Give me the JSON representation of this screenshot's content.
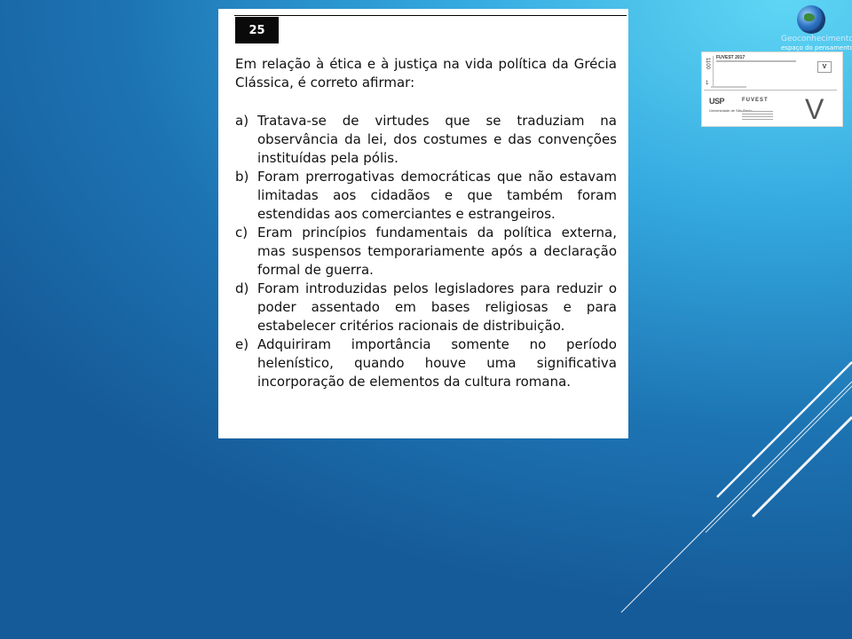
{
  "question": {
    "number": "25",
    "stem": "Em relação à ética e à justiça na vida política da Grécia Clássica, é correto afirmar:",
    "options": [
      {
        "letter": "a)",
        "text": "Tratava-se de virtudes que se traduziam na observância da lei, dos costumes e das convenções instituídas pela pólis."
      },
      {
        "letter": "b)",
        "text": "Foram prerrogativas democráticas que não estavam limitadas aos cidadãos e que também foram estendidas aos comerciantes e estrangeiros."
      },
      {
        "letter": "c)",
        "text": "Eram princípios fundamentais da política externa, mas suspensos temporariamente após a declaração formal de guerra."
      },
      {
        "letter": "d)",
        "text": "Foram introduzidas pelos legisladores para reduzir o poder assentado em bases religiosas e para estabelecer critérios racionais de distribuição."
      },
      {
        "letter": "e)",
        "text": "Adquiriram importância somente no período helenístico, quando houve uma significativa incorporação de elementos da cultura romana."
      }
    ]
  },
  "branding": {
    "site": "Geoconhecimento.com",
    "tagline": "espaço do pensamento",
    "logo_icon": "globe-icon"
  },
  "exam_thumbnail": {
    "number_top": "1100",
    "number_bottom": "1",
    "title": "FUVEST 2017",
    "version": "V",
    "university": "USP",
    "university_sub": "Universidade de São Paulo",
    "org": "FUVEST",
    "big_letter": "V"
  },
  "colors": {
    "background_light": "#5fd6f4",
    "background_dark": "#165b99",
    "card": "#ffffff",
    "number_box": "#0a0a0a"
  }
}
